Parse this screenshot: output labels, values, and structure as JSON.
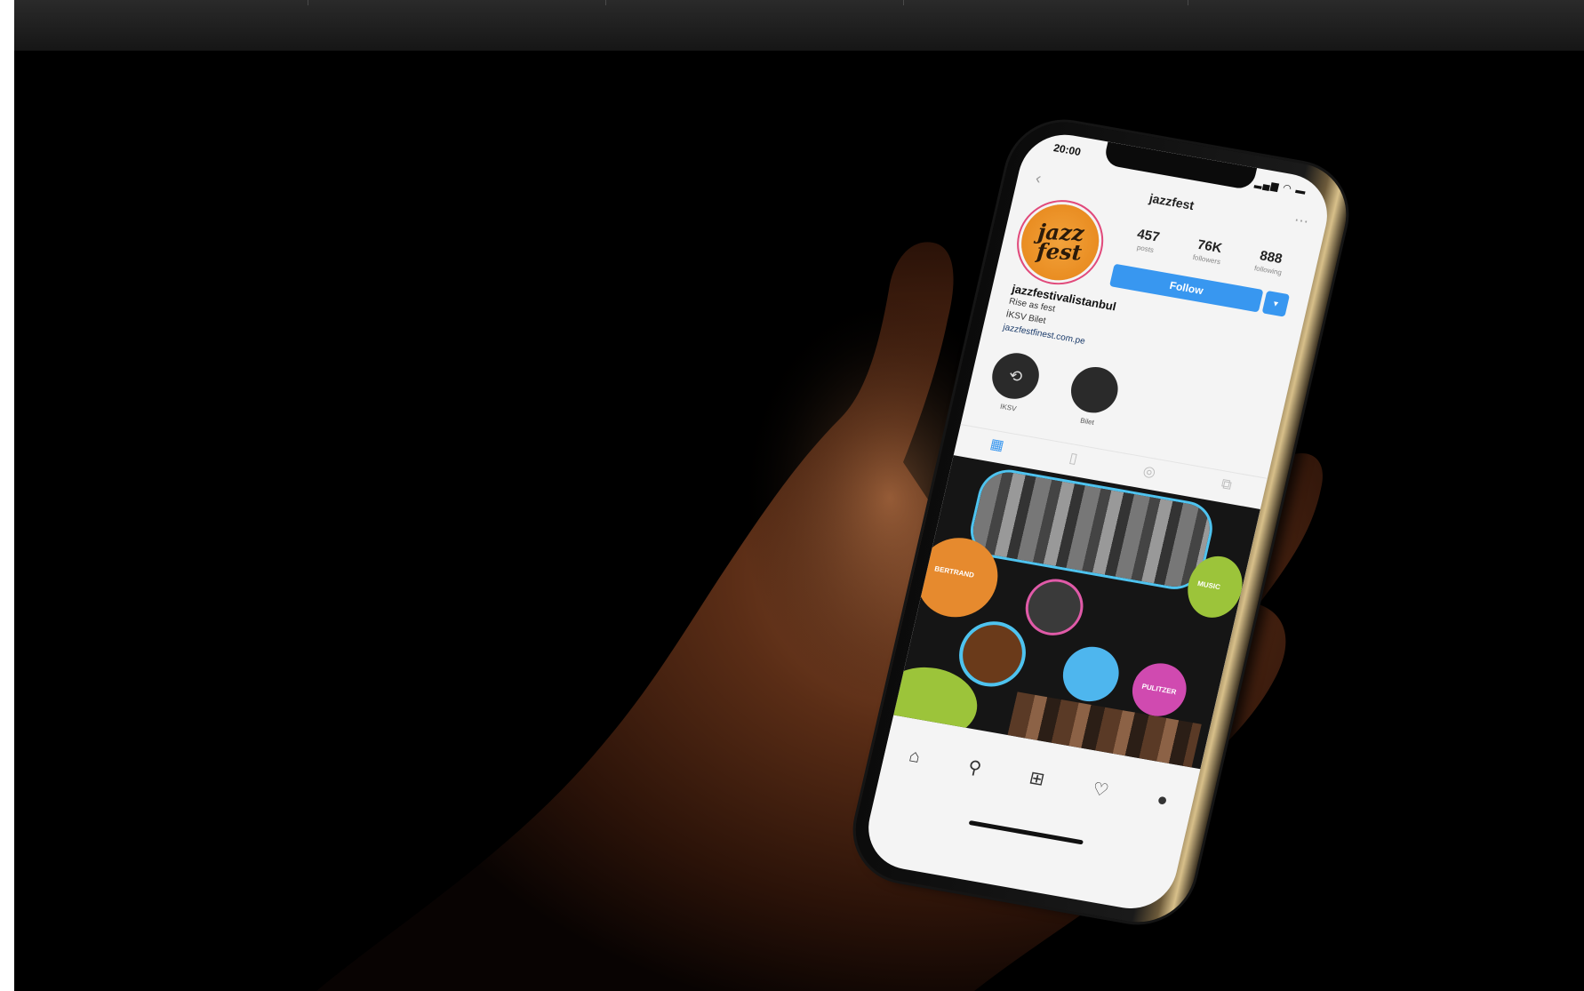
{
  "profile": {
    "status_time": "20:00",
    "status_icons": "▂▄▆ ◠ ▬",
    "nav_title": "jazzfest",
    "avatar_text": "jazz fest",
    "stats": [
      {
        "value": "457",
        "label": "posts"
      },
      {
        "value": "76K",
        "label": "followers"
      },
      {
        "value": "888",
        "label": "following"
      }
    ],
    "follow_label": "Follow",
    "bio_name": "jazzfestivalistanbul",
    "bio_lines": [
      "Rise as fest",
      "İKSV Bilet"
    ],
    "bio_link": "jazzfestfinest.com.pe",
    "highlights": [
      {
        "label": "IKSV"
      },
      {
        "label": "Bilet"
      }
    ],
    "grid_labels": [
      "BERTRAND",
      "MUSIC",
      "PULITZER"
    ]
  },
  "icons": {
    "back": "‹",
    "more": "⋯",
    "grid": "▦",
    "igtv": "▯",
    "reels": "◎",
    "tagged": "⧉",
    "home": "⌂",
    "search": "⚲",
    "add": "⊞",
    "heart": "♡",
    "profile": "●",
    "dropdown": "▾",
    "highlight_repeat": "⟲"
  }
}
